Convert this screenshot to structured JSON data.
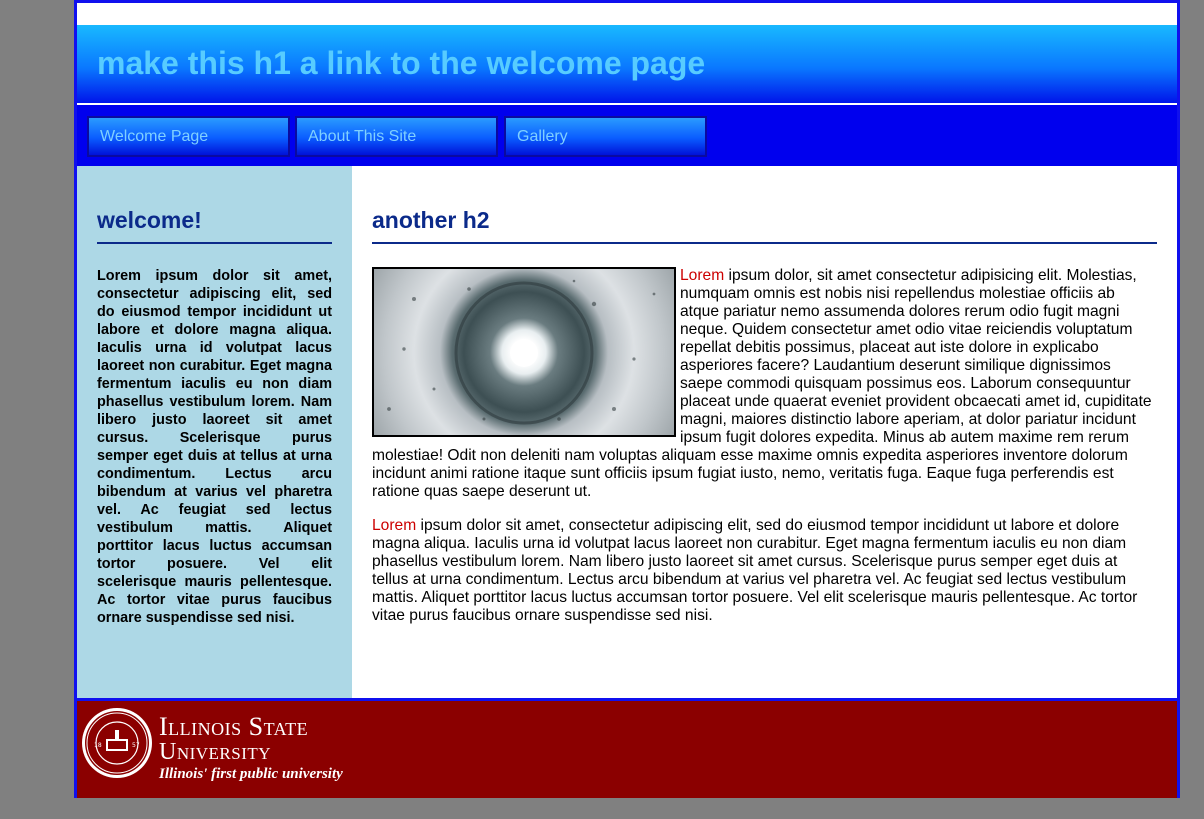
{
  "header": {
    "title": "make this h1 a link to the welcome page"
  },
  "nav": {
    "items": [
      {
        "label": "Welcome Page"
      },
      {
        "label": "About This Site"
      },
      {
        "label": "Gallery"
      }
    ]
  },
  "sidebar": {
    "heading": "welcome!",
    "text": "Lorem ipsum dolor sit amet, consectetur adipiscing elit, sed do eiusmod tempor incididunt ut labore et dolore magna aliqua. Iaculis urna id volutpat lacus laoreet non curabitur. Eget magna fermentum iaculis eu non diam phasellus vestibulum lorem. Nam libero justo laoreet sit amet cursus. Scelerisque purus semper eget duis at tellus at urna condimentum. Lectus arcu bibendum at varius vel pharetra vel. Ac feugiat sed lectus vestibulum mattis. Aliquet porttitor lacus luctus accumsan tortor posuere. Vel elit scelerisque mauris pellentesque. Ac tortor vitae purus faucibus ornare suspendisse sed nisi."
  },
  "main": {
    "heading": "another h2",
    "p1_lead": "Lorem",
    "p1_rest": " ipsum dolor, sit amet consectetur adipisicing elit. Molestias, numquam omnis est nobis nisi repellendus molestiae officiis ab atque pariatur nemo assumenda dolores rerum odio fugit magni neque. Quidem consectetur amet odio vitae reiciendis voluptatum repellat debitis possimus, placeat aut iste dolore in explicabo asperiores facere? Laudantium deserunt similique dignissimos saepe commodi quisquam possimus eos. Laborum consequuntur placeat unde quaerat eveniet provident obcaecati amet id, cupiditate magni, maiores distinctio labore aperiam, at dolor pariatur incidunt ipsum fugit dolores expedita. Minus ab autem maxime rem rerum molestiae! Odit non deleniti nam voluptas aliquam esse maxime omnis expedita asperiores inventore dolorum incidunt animi ratione itaque sunt officiis ipsum fugiat iusto, nemo, veritatis fuga. Eaque fuga perferendis est ratione quas saepe deserunt ut.",
    "p2_lead": "Lorem",
    "p2_rest": " ipsum dolor sit amet, consectetur adipiscing elit, sed do eiusmod tempor incididunt ut labore et dolore magna aliqua. Iaculis urna id volutpat lacus laoreet non curabitur. Eget magna fermentum iaculis eu non diam phasellus vestibulum lorem. Nam libero justo laoreet sit amet cursus. Scelerisque purus semper eget duis at tellus at urna condimentum. Lectus arcu bibendum at varius vel pharetra vel. Ac feugiat sed lectus vestibulum mattis. Aliquet porttitor lacus luctus accumsan tortor posuere. Vel elit scelerisque mauris pellentesque. Ac tortor vitae purus faucibus ornare suspendisse sed nisi."
  },
  "footer": {
    "university_line1": "Illinois State",
    "university_line2": "University",
    "tagline": "Illinois' first public university",
    "seal_text": "ILLINOIS STATE UNIVERSITY 1857",
    "seal_year_left": "18",
    "seal_year_right": "57"
  },
  "colors": {
    "page_bg": "#808080",
    "header_blue": "#0a78ff",
    "nav_blue": "#0000ee",
    "sidebar_bg": "#add8e6",
    "heading_blue": "#0b2a8a",
    "lorem_red": "#cc0000",
    "footer_red": "#8b0000"
  }
}
